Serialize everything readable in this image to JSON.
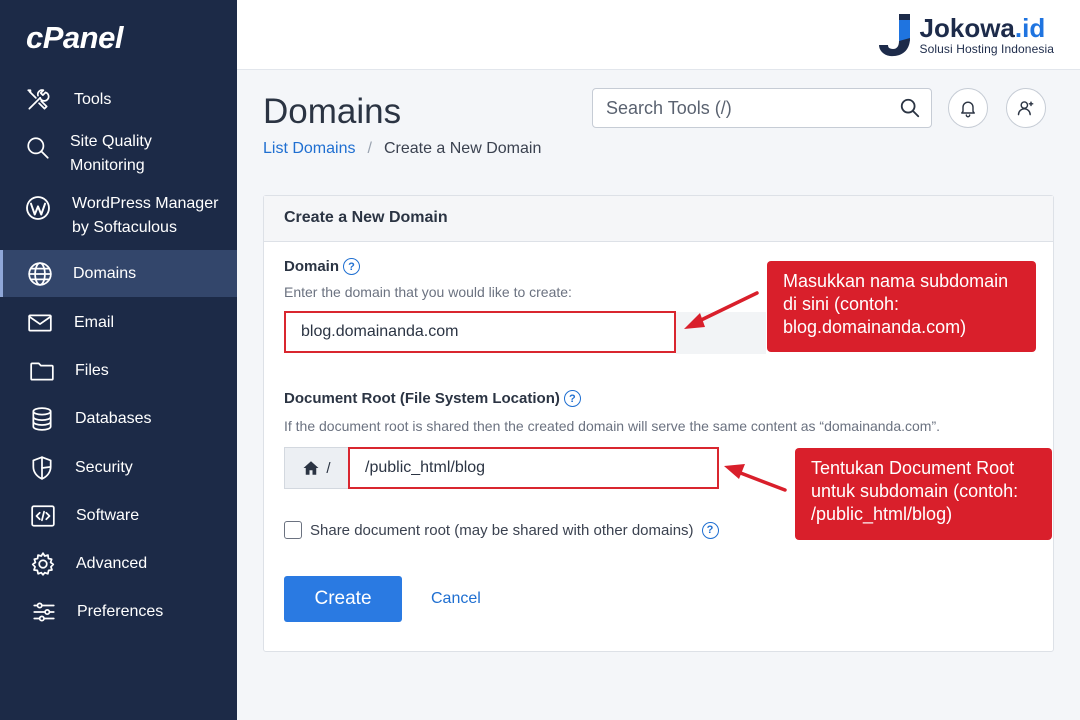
{
  "app": {
    "logo": "cPanel"
  },
  "brand": {
    "name_main": "Jokowa",
    "name_dot": ".id",
    "tagline": "Solusi Hosting Indonesia"
  },
  "sidebar": {
    "items": [
      {
        "label": "Tools",
        "icon": "tools-icon"
      },
      {
        "label": "Site Quality Monitoring",
        "icon": "search-icon"
      },
      {
        "label": "WordPress Manager by Softaculous",
        "icon": "wordpress-icon"
      },
      {
        "label": "Domains",
        "icon": "globe-icon",
        "active": true
      },
      {
        "label": "Email",
        "icon": "envelope-icon"
      },
      {
        "label": "Files",
        "icon": "folder-icon"
      },
      {
        "label": "Databases",
        "icon": "database-icon"
      },
      {
        "label": "Security",
        "icon": "shield-icon"
      },
      {
        "label": "Software",
        "icon": "code-icon"
      },
      {
        "label": "Advanced",
        "icon": "gear-icon"
      },
      {
        "label": "Preferences",
        "icon": "sliders-icon"
      }
    ]
  },
  "header": {
    "search_placeholder": "Search Tools (/)"
  },
  "page": {
    "title": "Domains",
    "breadcrumb": {
      "parent": "List Domains",
      "separator": "/",
      "current": "Create a New Domain"
    }
  },
  "form": {
    "panel_title": "Create a New Domain",
    "domain_label": "Domain",
    "domain_desc": "Enter the domain that you would like to create:",
    "domain_value": "blog.domainanda.com",
    "docroot_label": "Document Root (File System Location)",
    "docroot_desc": "If the document root is shared then the created domain will serve the same content as “domainanda.com”.",
    "docroot_prefix": "/",
    "docroot_value": "/public_html/blog",
    "share_label": "Share document root (may be shared with other domains)",
    "share_checked": false,
    "create_label": "Create",
    "cancel_label": "Cancel"
  },
  "annotations": {
    "callout1": "Masukkan nama subdomain di sini (contoh: blog.domainanda.com)",
    "callout2": "Tentukan Document Root untuk subdomain (contoh: /public_html/blog)"
  },
  "colors": {
    "sidebar": "#1c2a47",
    "accent": "#2a7ae2",
    "callout": "#d91f2b"
  }
}
